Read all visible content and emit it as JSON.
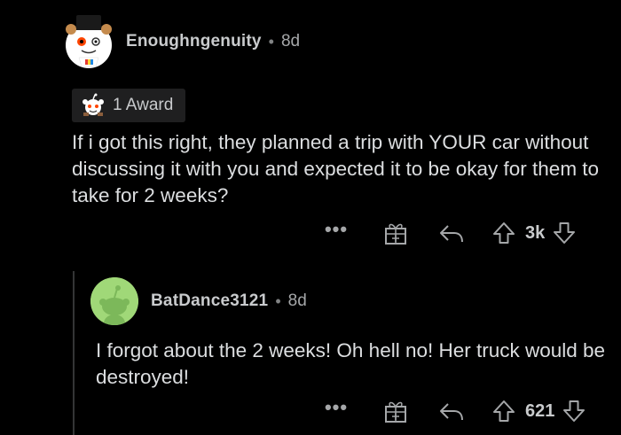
{
  "comments": [
    {
      "username": "Enoughngenuity",
      "separator": "•",
      "time": "8d",
      "award_label": "1 Award",
      "body": "If i got this right, they planned a trip with YOUR car without discussing it with you and expected it to be okay for them to take for 2 weeks?",
      "more_label": "•••",
      "score": "3k",
      "avatar_icon": "snoo-avatar-with-hat-icon",
      "award_icon": "award-snoo-icon"
    },
    {
      "username": "BatDance3121",
      "separator": "•",
      "time": "8d",
      "body": "I forgot about the 2 weeks! Oh hell no! Her truck would be destroyed!",
      "more_label": "•••",
      "score": "621",
      "avatar_icon": "default-snoo-avatar-icon"
    }
  ],
  "colors": {
    "background": "#000000",
    "text": "#dcdee0",
    "muted": "#a5a7a9",
    "award_chip": "#1f1f20",
    "avatar2_bg": "#a0d878"
  },
  "icons": [
    "gift-icon",
    "reply-icon",
    "upvote-arrow-icon",
    "downvote-arrow-icon",
    "more-options-icon"
  ]
}
